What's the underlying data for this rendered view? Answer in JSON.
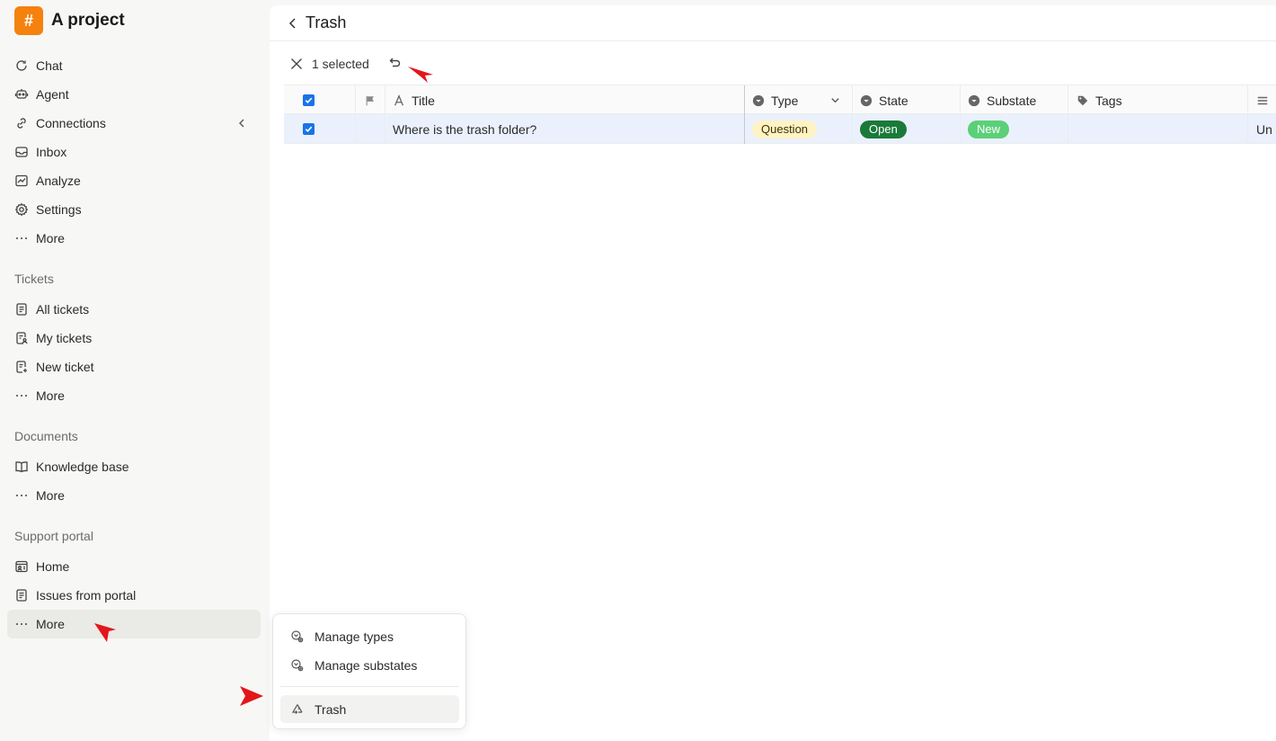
{
  "project": {
    "logo_glyph": "#",
    "name": "A project",
    "logo_color": "#f5810e"
  },
  "nav": {
    "chat": "Chat",
    "agent": "Agent",
    "connections": "Connections",
    "inbox": "Inbox",
    "analyze": "Analyze",
    "settings": "Settings",
    "more": "More"
  },
  "sections": {
    "tickets": {
      "label": "Tickets",
      "all": "All tickets",
      "mine": "My tickets",
      "new": "New ticket",
      "more": "More"
    },
    "documents": {
      "label": "Documents",
      "kb": "Knowledge base",
      "more": "More"
    },
    "portal": {
      "label": "Support portal",
      "home": "Home",
      "issues": "Issues from portal",
      "more": "More"
    }
  },
  "page": {
    "title": "Trash"
  },
  "toolbar": {
    "selected_text": "1 selected"
  },
  "table": {
    "columns": {
      "title": "Title",
      "type": "Type",
      "state": "State",
      "substate": "Substate",
      "tags": "Tags"
    },
    "rows": [
      {
        "title": "Where is the trash folder?",
        "type": "Question",
        "state": "Open",
        "substate": "New",
        "tags": "",
        "extra": "Un"
      }
    ]
  },
  "menu": {
    "manage_types": "Manage types",
    "manage_substates": "Manage substates",
    "trash": "Trash"
  },
  "colors": {
    "accent": "#1a73e8",
    "state_open": "#1a7a3a",
    "substate_new": "#5bd078",
    "type_question": "#fdf3c4",
    "annotation_arrow": "#e3161b"
  }
}
